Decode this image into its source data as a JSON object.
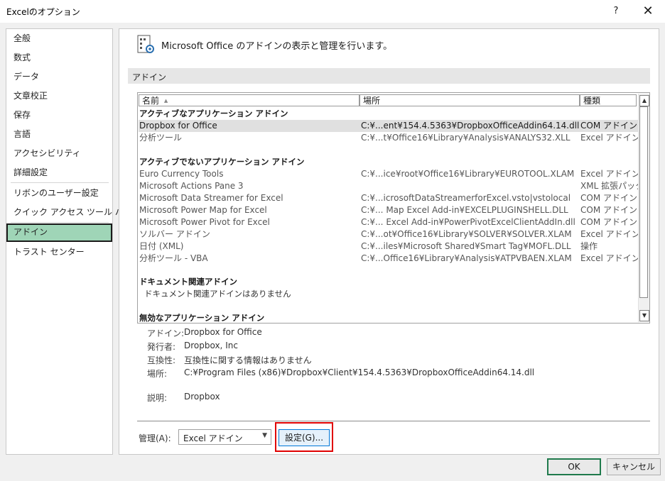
{
  "window": {
    "title": "Excelのオプション",
    "help": "?",
    "close": "✕"
  },
  "nav": {
    "items": [
      "全般",
      "数式",
      "データ",
      "文章校正",
      "保存",
      "言語",
      "アクセシビリティ",
      "詳細設定",
      "リボンのユーザー設定",
      "クイック アクセス ツール バー",
      "アドイン",
      "トラスト センター"
    ],
    "selected": "アドイン"
  },
  "header": {
    "text": "Microsoft Office のアドインの表示と管理を行います。",
    "icon": "addin-gear-icon"
  },
  "section": {
    "label": "アドイン"
  },
  "table": {
    "columns": [
      "名前",
      "場所",
      "種類"
    ],
    "sort_indicator": "▲",
    "active_group": "アクティブなアプリケーション アドイン",
    "active_rows": [
      {
        "name": "Dropbox for Office",
        "location": "C:¥...ent¥154.4.5363¥DropboxOfficeAddin64.14.dll",
        "type": "COM アドイン"
      },
      {
        "name": "分析ツール",
        "location": "C:¥...t¥Office16¥Library¥Analysis¥ANALYS32.XLL",
        "type": "Excel アドイン"
      }
    ],
    "inactive_group": "アクティブでないアプリケーション アドイン",
    "inactive_rows": [
      {
        "name": "Euro Currency Tools",
        "location": "C:¥...ice¥root¥Office16¥Library¥EUROTOOL.XLAM",
        "type": "Excel アドイン"
      },
      {
        "name": "Microsoft Actions Pane 3",
        "location": "",
        "type": "XML 拡張パック"
      },
      {
        "name": "Microsoft Data Streamer for Excel",
        "location": "C:¥...icrosoftDataStreamerforExcel.vsto|vstolocal",
        "type": "COM アドイン"
      },
      {
        "name": "Microsoft Power Map for Excel",
        "location": "C:¥... Map Excel Add-in¥EXCELPLUGINSHELL.DLL",
        "type": "COM アドイン"
      },
      {
        "name": "Microsoft Power Pivot for Excel",
        "location": "C:¥... Excel Add-in¥PowerPivotExcelClientAddIn.dll",
        "type": "COM アドイン"
      },
      {
        "name": "ソルバー アドイン",
        "location": "C:¥...ot¥Office16¥Library¥SOLVER¥SOLVER.XLAM",
        "type": "Excel アドイン"
      },
      {
        "name": "日付 (XML)",
        "location": "C:¥...iles¥Microsoft Shared¥Smart Tag¥MOFL.DLL",
        "type": "操作"
      },
      {
        "name": "分析ツール - VBA",
        "location": "C:¥...Office16¥Library¥Analysis¥ATPVBAEN.XLAM",
        "type": "Excel アドイン"
      }
    ],
    "doc_group": "ドキュメント関連アドイン",
    "doc_note": "ドキュメント関連アドインはありません",
    "disabled_group": "無効なアプリケーション アドイン"
  },
  "details": {
    "addin_label": "アドイン:",
    "addin_value": "Dropbox for Office",
    "publisher_label": "発行者:",
    "publisher_value": "Dropbox, Inc",
    "compat_label": "互換性:",
    "compat_value": "互換性に関する情報はありません",
    "location_label": "場所:",
    "location_value": "C:¥Program Files (x86)¥Dropbox¥Client¥154.4.5363¥DropboxOfficeAddin64.14.dll",
    "desc_label": "説明:",
    "desc_value": "Dropbox"
  },
  "manage": {
    "label": "管理(A):",
    "selected": "Excel アドイン",
    "go_button": "設定(G)..."
  },
  "footer": {
    "ok": "OK",
    "cancel": "キャンセル"
  }
}
